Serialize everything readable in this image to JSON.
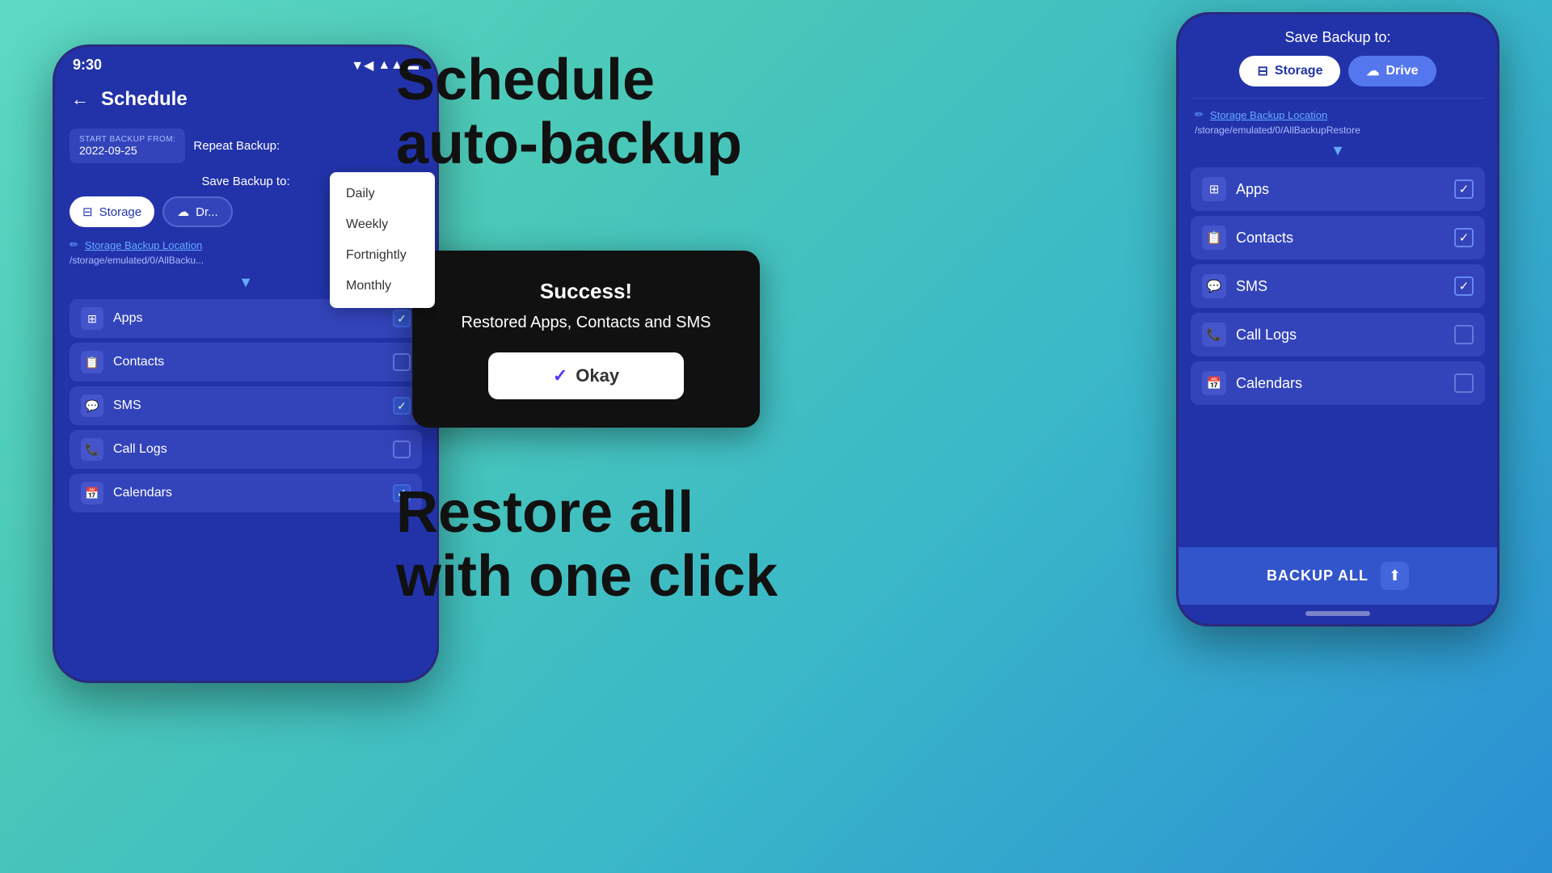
{
  "background": {
    "gradient_start": "#5dd9c4",
    "gradient_end": "#2a8fd4"
  },
  "phone_left": {
    "status_bar": {
      "time": "9:30",
      "signal": "▼",
      "wifi": "▲",
      "battery": "🔋"
    },
    "header": {
      "back_arrow": "←",
      "title": "Schedule"
    },
    "start_backup": {
      "label": "START BACKUP FROM:",
      "date": "2022-09-25"
    },
    "repeat_backup_label": "Repeat Backup:",
    "dropdown": {
      "items": [
        "Daily",
        "Weekly",
        "Fortnightly",
        "Monthly"
      ]
    },
    "save_backup_label": "Save Backup to:",
    "storage_btn": "Storage",
    "drive_btn": "Dr...",
    "storage_location_link": "Storage Backup Location",
    "storage_path": "/storage/emulated/0/AllBacku...",
    "expand_arrow": "▼",
    "backup_items": [
      {
        "label": "Apps",
        "checked": true,
        "icon": "⊞"
      },
      {
        "label": "Contacts",
        "checked": false,
        "icon": "📋"
      },
      {
        "label": "SMS",
        "checked": true,
        "icon": "💬"
      },
      {
        "label": "Call Logs",
        "checked": false,
        "icon": "📞"
      },
      {
        "label": "Calendars",
        "checked": true,
        "icon": "📅"
      }
    ]
  },
  "center": {
    "headline_line1": "Schedule",
    "headline_line2": "auto-backup",
    "success_dialog": {
      "title": "Success!",
      "message": "Restored Apps, Contacts and SMS",
      "okay_button": "Okay"
    },
    "restore_line1": "Restore all",
    "restore_line2": "with one click"
  },
  "phone_right": {
    "save_backup_label": "Save Backup to:",
    "storage_btn": "Storage",
    "drive_btn": "Drive",
    "storage_location_link": "Storage Backup Location",
    "storage_path": "/storage/emulated/0/AllBackupRestore",
    "expand_arrow": "▼",
    "backup_items": [
      {
        "label": "Apps",
        "checked": true,
        "icon": "⊞"
      },
      {
        "label": "Contacts",
        "checked": true,
        "icon": "📋"
      },
      {
        "label": "SMS",
        "checked": true,
        "icon": "💬"
      },
      {
        "label": "Call Logs",
        "checked": false,
        "icon": "📞"
      },
      {
        "label": "Calendars",
        "checked": false,
        "icon": "📅"
      }
    ],
    "backup_all_btn": "BACKUP ALL"
  }
}
